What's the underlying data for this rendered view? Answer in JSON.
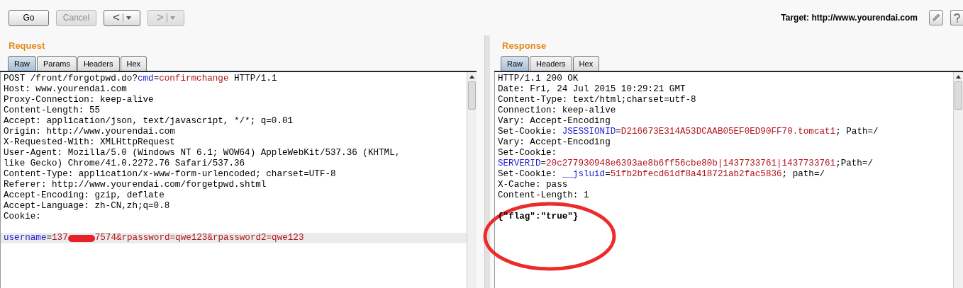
{
  "toolbar": {
    "buttons": [
      {
        "label": "Go",
        "disabled": false
      },
      {
        "label": "Cancel",
        "disabled": true
      }
    ],
    "history": [
      {
        "label": "<",
        "disabled": false
      },
      {
        "label": ">",
        "disabled": true
      }
    ],
    "target": "Target: http://www.yourendai.com"
  },
  "panels": [
    {
      "title": "Request",
      "tabs": [
        {
          "label": "Raw",
          "selected": true
        },
        {
          "label": "Params",
          "selected": false
        },
        {
          "label": "Headers",
          "selected": false
        },
        {
          "label": "Hex",
          "selected": false
        }
      ],
      "lines": [
        {
          "kind": "text",
          "highlighted": false,
          "segments": [
            {
              "kind": "plain",
              "text": "POST /front/forgotpwd.do?"
            },
            {
              "kind": "key",
              "text": "cmd"
            },
            {
              "kind": "plain",
              "text": "="
            },
            {
              "kind": "value",
              "text": "confirmchange"
            },
            {
              "kind": "plain",
              "text": " HTTP/1.1"
            }
          ]
        },
        {
          "kind": "text",
          "highlighted": false,
          "segments": [
            {
              "kind": "plain",
              "text": "Host: www.yourendai.com"
            }
          ]
        },
        {
          "kind": "text",
          "highlighted": false,
          "segments": [
            {
              "kind": "plain",
              "text": "Proxy-Connection: keep-alive"
            }
          ]
        },
        {
          "kind": "text",
          "highlighted": false,
          "segments": [
            {
              "kind": "plain",
              "text": "Content-Length: 55"
            }
          ]
        },
        {
          "kind": "text",
          "highlighted": false,
          "segments": [
            {
              "kind": "plain",
              "text": "Accept: application/json, text/javascript, */*; q=0.01"
            }
          ]
        },
        {
          "kind": "text",
          "highlighted": false,
          "segments": [
            {
              "kind": "plain",
              "text": "Origin: http://www.yourendai.com"
            }
          ]
        },
        {
          "kind": "text",
          "highlighted": false,
          "segments": [
            {
              "kind": "plain",
              "text": "X-Requested-With: XMLHttpRequest"
            }
          ]
        },
        {
          "kind": "text",
          "highlighted": false,
          "segments": [
            {
              "kind": "plain",
              "text": "User-Agent: Mozilla/5.0 (Windows NT 6.1; WOW64) AppleWebKit/537.36 (KHTML,"
            }
          ]
        },
        {
          "kind": "text",
          "highlighted": false,
          "segments": [
            {
              "kind": "plain",
              "text": "like Gecko) Chrome/41.0.2272.76 Safari/537.36"
            }
          ]
        },
        {
          "kind": "text",
          "highlighted": false,
          "segments": [
            {
              "kind": "plain",
              "text": "Content-Type: application/x-www-form-urlencoded; charset=UTF-8"
            }
          ]
        },
        {
          "kind": "text",
          "highlighted": false,
          "segments": [
            {
              "kind": "plain",
              "text": "Referer: http://www.yourendai.com/forgetpwd.shtml"
            }
          ]
        },
        {
          "kind": "text",
          "highlighted": false,
          "segments": [
            {
              "kind": "plain",
              "text": "Accept-Encoding: gzip, deflate"
            }
          ]
        },
        {
          "kind": "text",
          "highlighted": false,
          "segments": [
            {
              "kind": "plain",
              "text": "Accept-Language: zh-CN,zh;q=0.8"
            }
          ]
        },
        {
          "kind": "text",
          "highlighted": false,
          "segments": [
            {
              "kind": "plain",
              "text": "Cookie:"
            }
          ]
        },
        {
          "kind": "blank",
          "highlighted": false
        },
        {
          "kind": "text",
          "highlighted": true,
          "segments": [
            {
              "kind": "key",
              "text": "username"
            },
            {
              "kind": "plain",
              "text": "="
            },
            {
              "kind": "value",
              "text": "137"
            },
            {
              "kind": "redaction"
            },
            {
              "kind": "value",
              "text": "7574&rpassword=qwe123&rpassword2=qwe123"
            }
          ]
        }
      ]
    },
    {
      "title": "Response",
      "tabs": [
        {
          "label": "Raw",
          "selected": true
        },
        {
          "label": "Headers",
          "selected": false
        },
        {
          "label": "Hex",
          "selected": false
        }
      ],
      "lines": [
        {
          "kind": "text",
          "highlighted": false,
          "segments": [
            {
              "kind": "plain",
              "text": "HTTP/1.1 200 OK"
            }
          ]
        },
        {
          "kind": "text",
          "highlighted": false,
          "segments": [
            {
              "kind": "plain",
              "text": "Date: Fri, 24 Jul 2015 10:29:21 GMT"
            }
          ]
        },
        {
          "kind": "text",
          "highlighted": false,
          "segments": [
            {
              "kind": "plain",
              "text": "Content-Type: text/html;charset=utf-8"
            }
          ]
        },
        {
          "kind": "text",
          "highlighted": false,
          "segments": [
            {
              "kind": "plain",
              "text": "Connection: keep-alive"
            }
          ]
        },
        {
          "kind": "text",
          "highlighted": false,
          "segments": [
            {
              "kind": "plain",
              "text": "Vary: Accept-Encoding"
            }
          ]
        },
        {
          "kind": "text",
          "highlighted": false,
          "segments": [
            {
              "kind": "plain",
              "text": "Set-Cookie: "
            },
            {
              "kind": "key",
              "text": "JSESSIONID"
            },
            {
              "kind": "plain",
              "text": "="
            },
            {
              "kind": "value",
              "text": "D216673E314A53DCAAB05EF0ED90FF70.tomcat1"
            },
            {
              "kind": "plain",
              "text": "; Path=/"
            }
          ]
        },
        {
          "kind": "text",
          "highlighted": false,
          "segments": [
            {
              "kind": "plain",
              "text": "Vary: Accept-Encoding"
            }
          ]
        },
        {
          "kind": "text",
          "highlighted": false,
          "segments": [
            {
              "kind": "plain",
              "text": "Set-Cookie:"
            }
          ]
        },
        {
          "kind": "text",
          "highlighted": false,
          "segments": [
            {
              "kind": "key",
              "text": "SERVERID"
            },
            {
              "kind": "plain",
              "text": "="
            },
            {
              "kind": "value",
              "text": "20c277930948e6393ae8b6ff56cbe80b|1437733761|1437733761"
            },
            {
              "kind": "plain",
              "text": ";Path=/"
            }
          ]
        },
        {
          "kind": "text",
          "highlighted": false,
          "segments": [
            {
              "kind": "plain",
              "text": "Set-Cookie: "
            },
            {
              "kind": "key",
              "text": "__jsluid"
            },
            {
              "kind": "plain",
              "text": "="
            },
            {
              "kind": "value",
              "text": "51fb2bfecd61df8a418721ab2fac5836"
            },
            {
              "kind": "plain",
              "text": "; path=/"
            }
          ]
        },
        {
          "kind": "text",
          "highlighted": false,
          "segments": [
            {
              "kind": "plain",
              "text": "X-Cache: pass"
            }
          ]
        },
        {
          "kind": "text",
          "highlighted": false,
          "segments": [
            {
              "kind": "plain",
              "text": "Content-Length: 1"
            }
          ]
        },
        {
          "kind": "blank",
          "highlighted": false
        },
        {
          "kind": "text",
          "highlighted": false,
          "segments": [
            {
              "kind": "bold",
              "text": "{\"flag\":\"true\"}"
            }
          ]
        }
      ]
    }
  ]
}
